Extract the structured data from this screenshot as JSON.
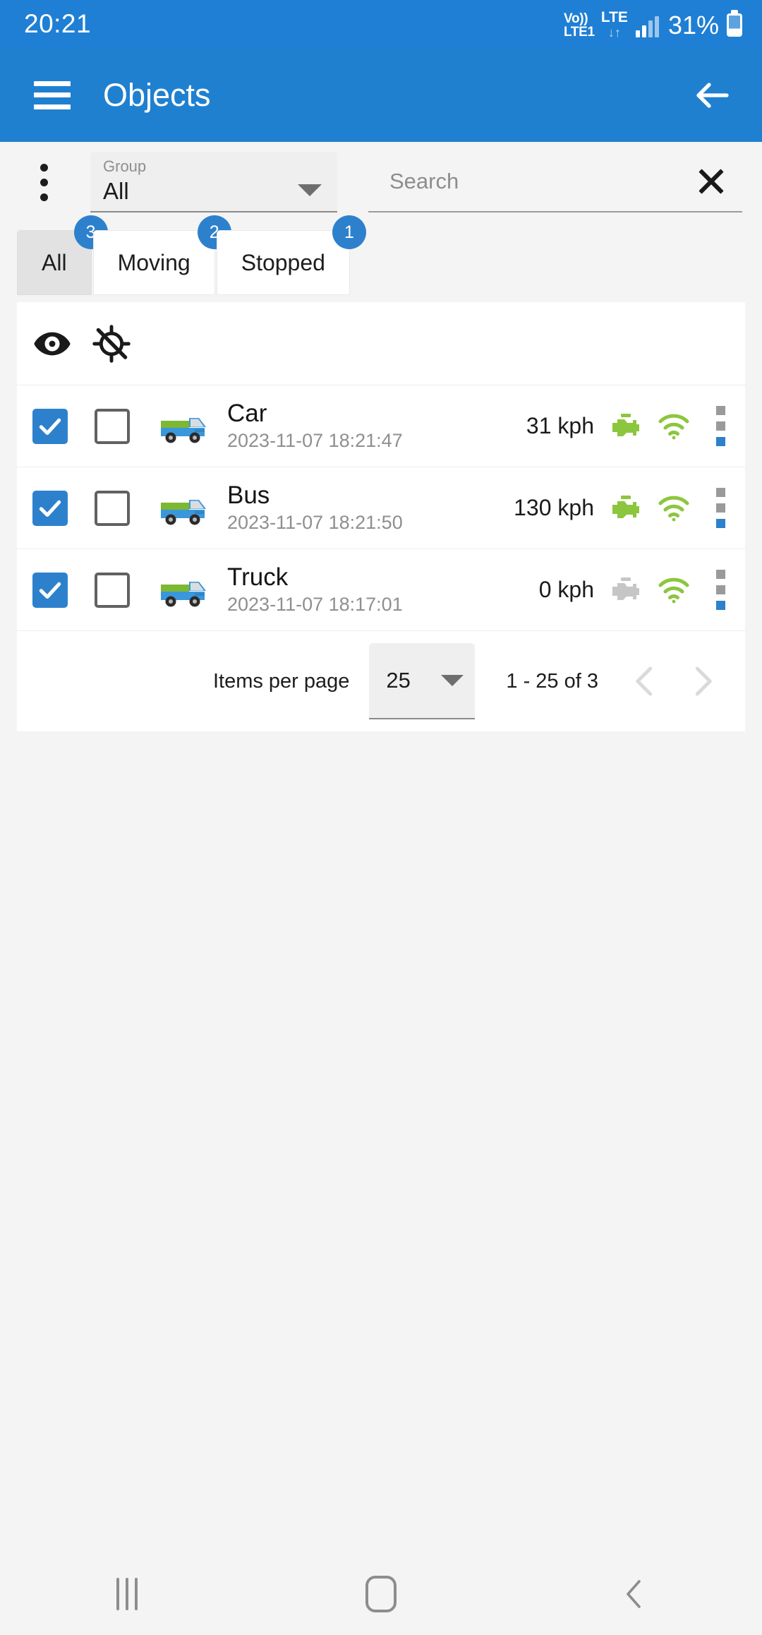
{
  "statusbar": {
    "time": "20:21",
    "volte_top": "Vo))",
    "volte_bottom": "LTE1",
    "lte_label": "LTE",
    "lte_arrows": "↓↑",
    "battery_percent": "31%"
  },
  "appbar": {
    "menu_icon": "hamburger-menu-icon",
    "title": "Objects",
    "back_icon": "arrow-back-icon"
  },
  "filters": {
    "overflow_icon": "more-vertical-icon",
    "group": {
      "label": "Group",
      "value": "All",
      "caret_icon": "chevron-down-icon"
    },
    "search": {
      "placeholder": "Search",
      "value": "",
      "clear_icon": "close-x-icon"
    }
  },
  "tabs": [
    {
      "label": "All",
      "badge": "3",
      "active": true
    },
    {
      "label": "Moving",
      "badge": "2",
      "active": false
    },
    {
      "label": "Stopped",
      "badge": "1",
      "active": false
    }
  ],
  "list_toolbar": {
    "visibility_icon": "eye-icon",
    "location_off_icon": "gps-off-icon"
  },
  "objects": [
    {
      "selected": true,
      "secondary_selected": false,
      "vehicle_icon": "truck-icon",
      "name": "Car",
      "timestamp": "2023-11-07 18:21:47",
      "speed": "31 kph",
      "engine_icon": "engine-icon",
      "engine_state": "on",
      "signal_icon": "wifi-icon",
      "signal_state": "on",
      "row_menu_icon": "more-vertical-icon"
    },
    {
      "selected": true,
      "secondary_selected": false,
      "vehicle_icon": "truck-icon",
      "name": "Bus",
      "timestamp": "2023-11-07 18:21:50",
      "speed": "130 kph",
      "engine_icon": "engine-icon",
      "engine_state": "on",
      "signal_icon": "wifi-icon",
      "signal_state": "on",
      "row_menu_icon": "more-vertical-icon"
    },
    {
      "selected": true,
      "secondary_selected": false,
      "vehicle_icon": "truck-icon",
      "name": "Truck",
      "timestamp": "2023-11-07 18:17:01",
      "speed": "0 kph",
      "engine_icon": "engine-icon",
      "engine_state": "off",
      "signal_icon": "wifi-icon",
      "signal_state": "on",
      "row_menu_icon": "more-vertical-icon"
    }
  ],
  "paginator": {
    "items_per_page_label": "Items per page",
    "items_per_page_value": "25",
    "range_label": "1 - 25 of 3",
    "prev_icon": "chevron-left-icon",
    "next_icon": "chevron-right-icon",
    "prev_disabled": true,
    "next_disabled": true
  },
  "navbar": {
    "recents_icon": "recents-icon",
    "home_icon": "home-icon",
    "back_icon": "back-icon"
  },
  "colors": {
    "statusbar_blue": "#1f7fd4",
    "appbar_blue": "#2080d0",
    "accent_blue": "#2d81cc",
    "engine_on_green": "#8cc63e",
    "engine_off_gray": "#c6c6c6",
    "page_background": "#f4f4f4"
  }
}
